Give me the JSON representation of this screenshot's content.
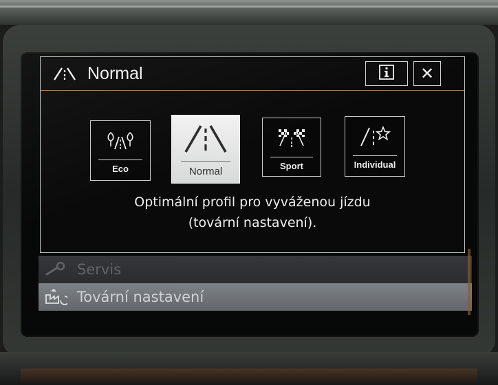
{
  "popup": {
    "title": "Normal",
    "info_icon": "info-icon",
    "close_icon": "close-icon",
    "close_label": "✕",
    "modes": [
      {
        "label": "Eco",
        "icon": "eco-trees-road-icon",
        "selected": false
      },
      {
        "label": "Normal",
        "icon": "road-icon",
        "selected": true
      },
      {
        "label": "Sport",
        "icon": "checkered-flags-icon",
        "selected": false
      },
      {
        "label": "Individual",
        "icon": "road-star-icon",
        "selected": false
      }
    ],
    "description_line1": "Optimální profil pro vyváženou jízdu",
    "description_line2": "(tovární nastavení)."
  },
  "menu": {
    "items": [
      {
        "label": "Servis",
        "icon": "wrench-icon"
      },
      {
        "label": "Tovární nastavení",
        "icon": "factory-reset-icon"
      }
    ]
  },
  "colors": {
    "accent": "#c07a2a",
    "popup_bg": "#0a0a0a",
    "tile_selected_bg": "#e6e7e7",
    "menu_item_bg": "#63676b"
  }
}
